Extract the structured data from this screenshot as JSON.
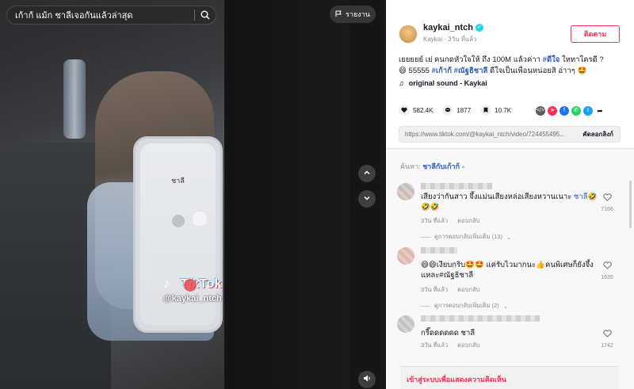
{
  "video": {
    "search_placeholder": "เก้าก้ แม้ก ชาลีเจอกันแล้วล่าสุด",
    "report_label": "รายงาน",
    "phone_title": "ชาลี",
    "watermark_brand": "TikTok",
    "watermark_user": "@kaykai_ntch"
  },
  "creator": {
    "username": "kaykai_ntch",
    "display_and_time": "Kaykai · 3วัน ที่แล้ว",
    "follow_label": "ติดตาม"
  },
  "caption": {
    "line1_text": "เยยยยย์ เย่ ",
    "line1_mid": "คนกดหัวใจให้  ถึง 100M แล้วค่าา ",
    "tag1": "#ดีใจ",
    "line1_end": " ใหทาใครดี ?",
    "line2_start": "😄 55555 ",
    "tag2": "#เก้าก้",
    "tag3": "#ณัฐธิชาลี",
    "line2_end": " ดีใจเป็นเพื่อนหน่อยสิ อ่าาๆ 🤩"
  },
  "sound": {
    "label": "original sound - Kaykai"
  },
  "stats": {
    "likes": "582.4K",
    "comments": "1877",
    "saves": "10.7K"
  },
  "link": {
    "url": "https://www.tiktok.com/@kaykai_ntch/video/724455495...",
    "copy_label": "คัดลอกลิงก์"
  },
  "comments_section": {
    "search_prefix": "ค้นหา:",
    "search_keyword": "ชาลีกับเก้าก้",
    "items": [
      {
        "text_a": "เสียงว่ากันสาว จึ้งแม่นเสียงหล่อเสียงหวานเนาะ ",
        "keyword": "ชาลี",
        "text_b": "🤣🤣🤣",
        "time": "3วัน ที่แล้ว",
        "reply": "ตอบกลับ",
        "likes": "7166",
        "more": "ดูการตอบกลับเพิ่มเติม (13)"
      },
      {
        "text_a": "😄😄เงียบกริบ🤩🤩 แค่รับไวมากนะ👍คนพิเศษก็ยังจึ้งแหละ#ณัฐธิชาลี",
        "keyword": "",
        "text_b": "",
        "time": "3วัน ที่แล้ว",
        "reply": "ตอบกลับ",
        "likes": "1635",
        "more": "ดูการตอบกลับเพิ่มเติม (2)"
      },
      {
        "text_a": "กรี๊ดดดดดด ชาลี ",
        "keyword": "",
        "text_b": "",
        "time": "3วัน ที่แล้ว",
        "reply": "ตอบกลับ",
        "likes": "1742",
        "more": ""
      }
    ],
    "login_prompt": "เข้าสู่ระบบเพื่อแสดงความคิดเห็น"
  },
  "colors": {
    "accent": "#fe2c55",
    "link": "#2b5db9",
    "verified": "#20d5ec"
  }
}
